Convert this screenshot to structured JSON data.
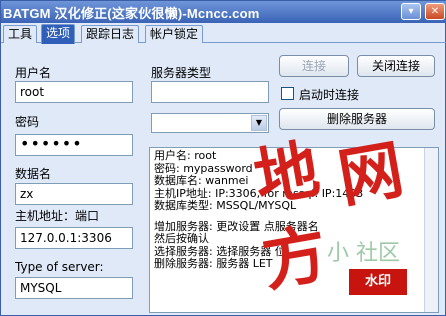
{
  "window": {
    "title": "BATGM 汉化修正(这家伙很懒)-Mcncc.com",
    "minimize_glyph": "▾",
    "close_glyph": "✕"
  },
  "tabs": [
    {
      "label": "工具"
    },
    {
      "label": "选项"
    },
    {
      "label": "跟踪日志"
    },
    {
      "label": "帐户锁定"
    }
  ],
  "form": {
    "username_label": "用户名",
    "username_value": "root",
    "password_label": "密码",
    "password_value": "••••••",
    "dbname_label": "数据名",
    "dbname_value": "zx",
    "host_label": "主机地址：端口",
    "host_value": "127.0.0.1:3306",
    "server_type_label": "Type of server:",
    "server_type_value": "MYSQL",
    "server_class_label": "服务器类型",
    "server_class_value": ""
  },
  "buttons": {
    "connect": "连接",
    "disconnect": "关闭连接",
    "delete_server": "删除服务器"
  },
  "checkbox": {
    "autoconnect_label": "启动时连接"
  },
  "info": {
    "lines": [
      "用户名: root",
      "密码: mypassword",
      "数据库名: wanmei",
      "主机IP地址: IP:3306, for mssql: IP:1433",
      "数据库类型: MSSQL/MYSQL",
      "",
      "增加服务器: 更改设置 点服务器名",
      "然后按确认",
      "选择服务器: 选择服务器 位",
      "删除服务器: 服务器 LET"
    ]
  },
  "watermark": {
    "big_1": "地",
    "big_2": "网",
    "big_3": "方",
    "small": "小 社区",
    "stamp": "水印"
  },
  "colors": {
    "title_bar": "#3a63b6",
    "active_tab": "#2f5fb8",
    "watermark_red": "#d3201a"
  }
}
